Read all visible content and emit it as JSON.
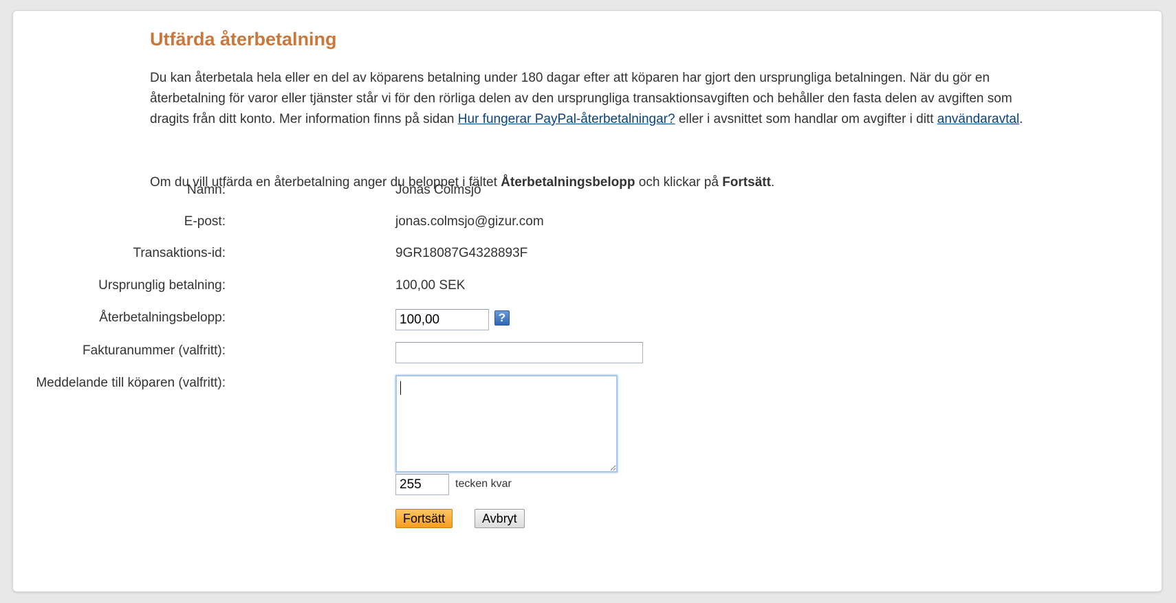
{
  "page": {
    "title": "Utfärda återbetalning",
    "intro": {
      "text_before_link1": "Du kan återbetala hela eller en del av köparens betalning under 180 dagar efter att köparen har gjort den ursprungliga betalningen. När du gör en återbetalning för varor eller tjänster står vi för den rörliga delen av den ursprungliga transaktionsavgiften och behåller den fasta delen av avgiften som dragits från ditt konto. Mer information finns på sidan ",
      "link1": "Hur fungerar PayPal-återbetalningar?",
      "text_between_links": " eller i avsnittet som handlar om avgifter i ditt ",
      "link2": "användaravtal",
      "text_after_link2": "."
    },
    "instruction": {
      "part1": "Om du vill utfärda en återbetalning anger du beloppet i fältet ",
      "bold1": "Återbetalningsbelopp",
      "part2": " och klickar på ",
      "bold2": "Fortsätt",
      "part3": "."
    }
  },
  "form": {
    "name_label": "Namn:",
    "name_value": "Jonas Colmsjö",
    "email_label": "E-post:",
    "email_value": "jonas.colmsjo@gizur.com",
    "transaction_label": "Transaktions-id:",
    "transaction_value": "9GR18087G4328893F",
    "original_payment_label": "Ursprunglig betalning:",
    "original_payment_value": "100,00 SEK",
    "refund_amount_label": "Återbetalningsbelopp:",
    "refund_amount_value": "100,00",
    "help_icon": "question-mark-icon",
    "help_icon_glyph": "?",
    "invoice_label": "Fakturanummer (valfritt):",
    "invoice_value": "",
    "message_label": "Meddelande till köparen (valfritt):",
    "message_value": "",
    "chars_left_value": "255",
    "chars_left_suffix": "tecken kvar"
  },
  "buttons": {
    "continue_label": "Fortsätt",
    "cancel_label": "Avbryt"
  },
  "colors": {
    "title": "#c9773a",
    "link": "#084482",
    "primary_button": "#f59d1f"
  }
}
